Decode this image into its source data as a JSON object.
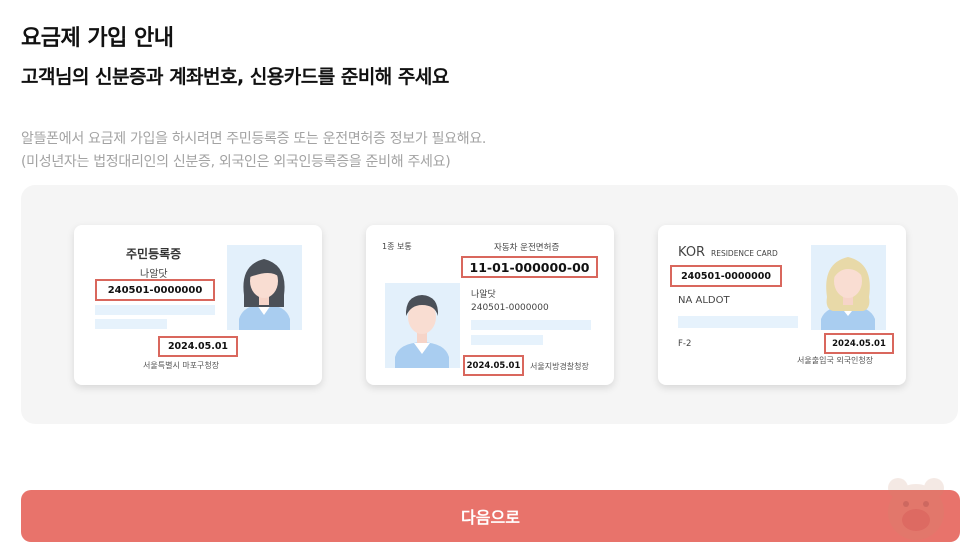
{
  "page": {
    "title": "요금제 가입 안내",
    "subtitle": "고객님의 신분증과 계좌번호, 신용카드를 준비해 주세요",
    "desc_line1": "알뜰폰에서 요금제 가입을 하시려면 주민등록증 또는 운전면허증 정보가 필요해요.",
    "desc_line2": "(미성년자는 법정대리인의 신분증, 외국인은 외국인등록증을 준비해 주세요)"
  },
  "cards": {
    "resident": {
      "heading": "주민등록증",
      "name": "나알닷",
      "number": "240501-0000000",
      "date": "2024.05.01",
      "issuer": "서울특별시 마포구청장"
    },
    "license": {
      "grade": "1종 보통",
      "heading": "자동차 운전면허증",
      "license_number": "11-01-000000-00",
      "name": "나알닷",
      "number": "240501-0000000",
      "date": "2024.05.01",
      "issuer": "서울지방경찰청장"
    },
    "foreign": {
      "country": "KOR",
      "heading": "RESIDENCE CARD",
      "number": "240501-0000000",
      "name": "NA ALDOT",
      "visa": "F-2",
      "date": "2024.05.01",
      "issuer": "서울출입국 외국인청장"
    }
  },
  "next_button": {
    "label": "다음으로"
  },
  "colors": {
    "accent": "#e8736b",
    "highlight_border": "#d9675d",
    "panel_bg": "#f5f5f5",
    "placeholder_bar": "#e6f2fc"
  }
}
